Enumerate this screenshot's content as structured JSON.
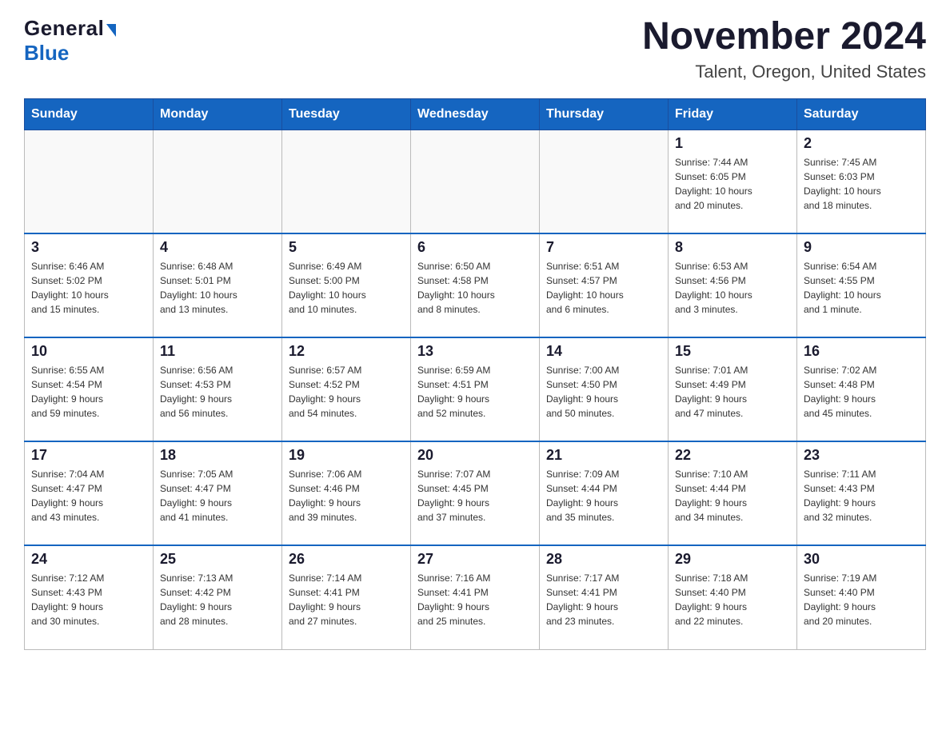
{
  "header": {
    "logo_general": "General",
    "logo_blue": "Blue",
    "title": "November 2024",
    "subtitle": "Talent, Oregon, United States"
  },
  "days_of_week": [
    "Sunday",
    "Monday",
    "Tuesday",
    "Wednesday",
    "Thursday",
    "Friday",
    "Saturday"
  ],
  "weeks": [
    [
      {
        "day": "",
        "info": ""
      },
      {
        "day": "",
        "info": ""
      },
      {
        "day": "",
        "info": ""
      },
      {
        "day": "",
        "info": ""
      },
      {
        "day": "",
        "info": ""
      },
      {
        "day": "1",
        "info": "Sunrise: 7:44 AM\nSunset: 6:05 PM\nDaylight: 10 hours\nand 20 minutes."
      },
      {
        "day": "2",
        "info": "Sunrise: 7:45 AM\nSunset: 6:03 PM\nDaylight: 10 hours\nand 18 minutes."
      }
    ],
    [
      {
        "day": "3",
        "info": "Sunrise: 6:46 AM\nSunset: 5:02 PM\nDaylight: 10 hours\nand 15 minutes."
      },
      {
        "day": "4",
        "info": "Sunrise: 6:48 AM\nSunset: 5:01 PM\nDaylight: 10 hours\nand 13 minutes."
      },
      {
        "day": "5",
        "info": "Sunrise: 6:49 AM\nSunset: 5:00 PM\nDaylight: 10 hours\nand 10 minutes."
      },
      {
        "day": "6",
        "info": "Sunrise: 6:50 AM\nSunset: 4:58 PM\nDaylight: 10 hours\nand 8 minutes."
      },
      {
        "day": "7",
        "info": "Sunrise: 6:51 AM\nSunset: 4:57 PM\nDaylight: 10 hours\nand 6 minutes."
      },
      {
        "day": "8",
        "info": "Sunrise: 6:53 AM\nSunset: 4:56 PM\nDaylight: 10 hours\nand 3 minutes."
      },
      {
        "day": "9",
        "info": "Sunrise: 6:54 AM\nSunset: 4:55 PM\nDaylight: 10 hours\nand 1 minute."
      }
    ],
    [
      {
        "day": "10",
        "info": "Sunrise: 6:55 AM\nSunset: 4:54 PM\nDaylight: 9 hours\nand 59 minutes."
      },
      {
        "day": "11",
        "info": "Sunrise: 6:56 AM\nSunset: 4:53 PM\nDaylight: 9 hours\nand 56 minutes."
      },
      {
        "day": "12",
        "info": "Sunrise: 6:57 AM\nSunset: 4:52 PM\nDaylight: 9 hours\nand 54 minutes."
      },
      {
        "day": "13",
        "info": "Sunrise: 6:59 AM\nSunset: 4:51 PM\nDaylight: 9 hours\nand 52 minutes."
      },
      {
        "day": "14",
        "info": "Sunrise: 7:00 AM\nSunset: 4:50 PM\nDaylight: 9 hours\nand 50 minutes."
      },
      {
        "day": "15",
        "info": "Sunrise: 7:01 AM\nSunset: 4:49 PM\nDaylight: 9 hours\nand 47 minutes."
      },
      {
        "day": "16",
        "info": "Sunrise: 7:02 AM\nSunset: 4:48 PM\nDaylight: 9 hours\nand 45 minutes."
      }
    ],
    [
      {
        "day": "17",
        "info": "Sunrise: 7:04 AM\nSunset: 4:47 PM\nDaylight: 9 hours\nand 43 minutes."
      },
      {
        "day": "18",
        "info": "Sunrise: 7:05 AM\nSunset: 4:47 PM\nDaylight: 9 hours\nand 41 minutes."
      },
      {
        "day": "19",
        "info": "Sunrise: 7:06 AM\nSunset: 4:46 PM\nDaylight: 9 hours\nand 39 minutes."
      },
      {
        "day": "20",
        "info": "Sunrise: 7:07 AM\nSunset: 4:45 PM\nDaylight: 9 hours\nand 37 minutes."
      },
      {
        "day": "21",
        "info": "Sunrise: 7:09 AM\nSunset: 4:44 PM\nDaylight: 9 hours\nand 35 minutes."
      },
      {
        "day": "22",
        "info": "Sunrise: 7:10 AM\nSunset: 4:44 PM\nDaylight: 9 hours\nand 34 minutes."
      },
      {
        "day": "23",
        "info": "Sunrise: 7:11 AM\nSunset: 4:43 PM\nDaylight: 9 hours\nand 32 minutes."
      }
    ],
    [
      {
        "day": "24",
        "info": "Sunrise: 7:12 AM\nSunset: 4:43 PM\nDaylight: 9 hours\nand 30 minutes."
      },
      {
        "day": "25",
        "info": "Sunrise: 7:13 AM\nSunset: 4:42 PM\nDaylight: 9 hours\nand 28 minutes."
      },
      {
        "day": "26",
        "info": "Sunrise: 7:14 AM\nSunset: 4:41 PM\nDaylight: 9 hours\nand 27 minutes."
      },
      {
        "day": "27",
        "info": "Sunrise: 7:16 AM\nSunset: 4:41 PM\nDaylight: 9 hours\nand 25 minutes."
      },
      {
        "day": "28",
        "info": "Sunrise: 7:17 AM\nSunset: 4:41 PM\nDaylight: 9 hours\nand 23 minutes."
      },
      {
        "day": "29",
        "info": "Sunrise: 7:18 AM\nSunset: 4:40 PM\nDaylight: 9 hours\nand 22 minutes."
      },
      {
        "day": "30",
        "info": "Sunrise: 7:19 AM\nSunset: 4:40 PM\nDaylight: 9 hours\nand 20 minutes."
      }
    ]
  ]
}
